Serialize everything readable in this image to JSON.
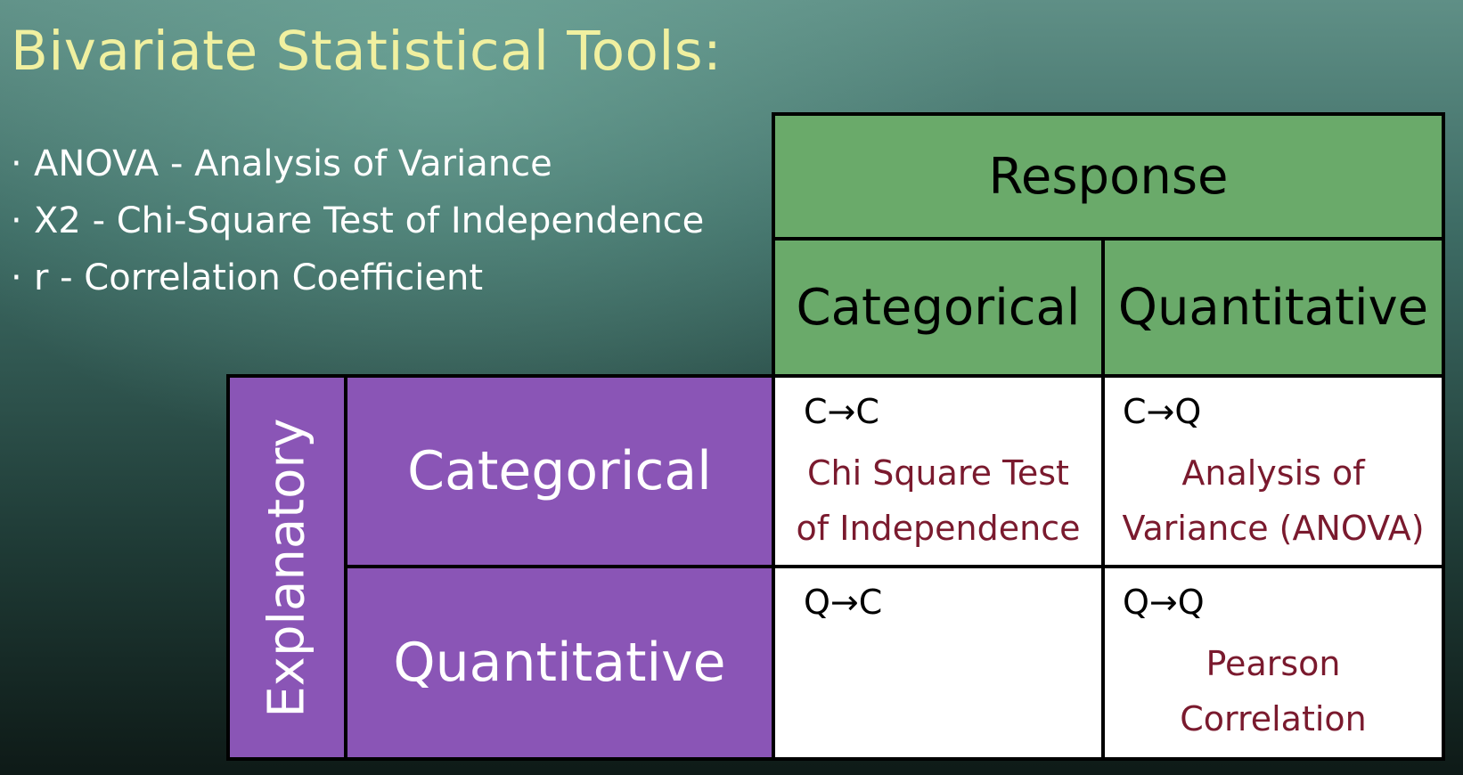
{
  "title": "Bivariate Statistical Tools:",
  "bullets": [
    {
      "marker": "·",
      "text": "ANOVA - Analysis of Variance"
    },
    {
      "marker": "·",
      "text": "X2 - Chi-Square Test of Independence"
    },
    {
      "marker": "·",
      "text": "r - Correlation Coefficient"
    }
  ],
  "table": {
    "response_header": "Response",
    "explanatory_header": "Explanatory",
    "columns": [
      "Categorical",
      "Quantitative"
    ],
    "rows": [
      "Categorical",
      "Quantitative"
    ],
    "cells": [
      [
        {
          "code": "C→C",
          "method_lines": [
            "Chi Square Test",
            "of Independence"
          ]
        },
        {
          "code": "C→Q",
          "method_lines": [
            "Analysis of",
            "Variance (ANOVA)"
          ]
        }
      ],
      [
        {
          "code": "Q→C",
          "method_lines": []
        },
        {
          "code": "Q→Q",
          "method_lines": [
            "Pearson",
            "Correlation"
          ]
        }
      ]
    ]
  },
  "colors": {
    "title": "#f0f0a0",
    "response_header_bg": "#6aaa6a",
    "explanatory_bg": "#8a55b6",
    "method_text": "#7a1a2e"
  }
}
